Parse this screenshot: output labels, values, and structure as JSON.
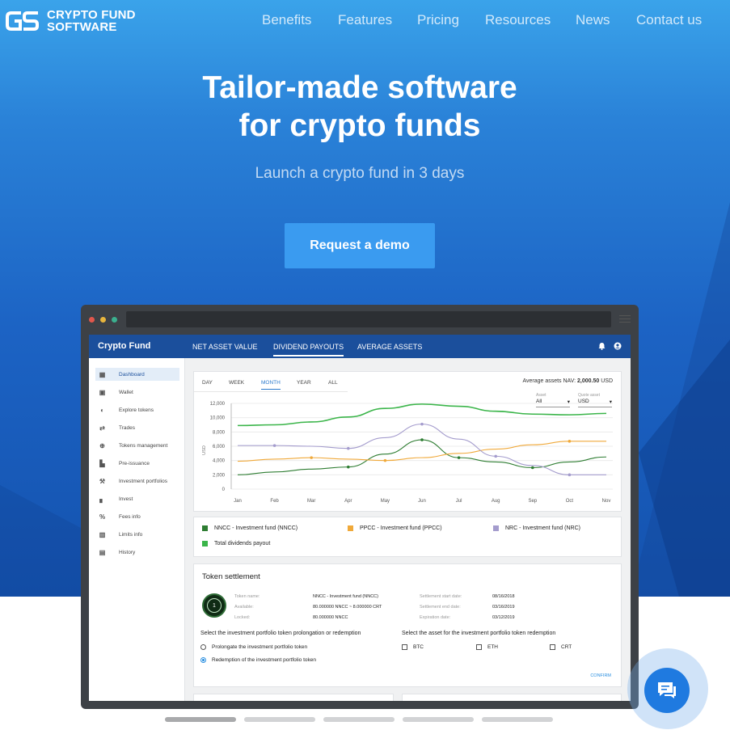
{
  "brand": {
    "line1": "CRYPTO FUND",
    "line2": "SOFTWARE",
    "mark": "GS"
  },
  "nav": [
    "Benefits",
    "Features",
    "Pricing",
    "Resources",
    "News",
    "Contact us"
  ],
  "hero": {
    "title_line1": "Tailor-made software",
    "title_line2": "for crypto funds",
    "subtitle": "Launch a crypto fund in 3 days",
    "cta": "Request a demo"
  },
  "app": {
    "title": "Crypto Fund",
    "tabs": [
      "NET ASSET VALUE",
      "DIVIDEND PAYOUTS",
      "AVERAGE ASSETS"
    ],
    "active_tab": 1,
    "sidebar": [
      {
        "label": "Dashboard",
        "icon": "dashboard-icon"
      },
      {
        "label": "Wallet",
        "icon": "wallet-icon"
      },
      {
        "label": "Explore tokens",
        "icon": "toggle-icon"
      },
      {
        "label": "Trades",
        "icon": "swap-icon"
      },
      {
        "label": "Tokens management",
        "icon": "plus-circle-icon"
      },
      {
        "label": "Pre-issuance",
        "icon": "document-icon"
      },
      {
        "label": "Investment portfolios",
        "icon": "gavel-icon"
      },
      {
        "label": "Invest",
        "icon": "signal-icon"
      },
      {
        "label": "Fees info",
        "icon": "percent-icon"
      },
      {
        "label": "Limits info",
        "icon": "bar-chart-icon"
      },
      {
        "label": "History",
        "icon": "history-icon"
      }
    ],
    "ranges": [
      "DAY",
      "WEEK",
      "MONTH",
      "YEAR",
      "ALL"
    ],
    "active_range": 2,
    "nav_label": "Average assets NAV:",
    "nav_value": "2,000.50",
    "nav_unit": "USD",
    "asset_select": {
      "caption": "Asset",
      "value": "All"
    },
    "quote_select": {
      "caption": "Quote asset",
      "value": "USD"
    },
    "legend": [
      "NNCC - Investment fund (NNCC)",
      "PPCC - Investment fund (PPCC)",
      "NRC - Investment fund (NRC)",
      "Total dividends payout"
    ],
    "token_settlement": {
      "title": "Token settlement",
      "badge": "1",
      "left_keys": [
        "Token name:",
        "Available:",
        "Locked:"
      ],
      "left_vals": [
        "NNCC - Investment fund (NNCC)",
        "80.000000 NNCC ~ 8.000000 CRT",
        "80.000000 NNCC"
      ],
      "right_keys": [
        "Settlement start date:",
        "Settlement end date:",
        "Expiration date:"
      ],
      "right_vals": [
        "08/16/2018",
        "03/16/2019",
        "03/12/2019"
      ],
      "q_left": "Select the investment portfolio token prolongation or redemption",
      "q_right": "Select the asset for the investment portfolio token redemption",
      "options": [
        "Prolongate the investment portfolio token",
        "Redemption of the investment portfolio token"
      ],
      "selected_option": 1,
      "assets": [
        "BTC",
        "ETH",
        "CRT"
      ],
      "confirm": "CONFIRM"
    }
  },
  "chart_data": {
    "type": "line",
    "categories": [
      "Jan",
      "Feb",
      "Mar",
      "Apr",
      "May",
      "Jun",
      "Jul",
      "Aug",
      "Sep",
      "Oct",
      "Nov"
    ],
    "ylabel": "USD",
    "ylim": [
      0,
      12000
    ],
    "yticks": [
      "12,000",
      "10,000",
      "8,000",
      "6,000",
      "4,000",
      "2,000",
      "0"
    ],
    "grid": true,
    "series": [
      {
        "name": "NNCC - Investment fund (NNCC)",
        "color": "#2e7d32",
        "values": [
          2000,
          2400,
          2800,
          3100,
          4900,
          6900,
          4400,
          3800,
          3000,
          3800,
          4500
        ],
        "markers": [
          3,
          5,
          6,
          8
        ]
      },
      {
        "name": "PPCC - Investment fund (PPCC)",
        "color": "#f0a93a",
        "values": [
          3900,
          4200,
          4400,
          4200,
          4000,
          4400,
          5000,
          5600,
          6200,
          6700,
          6700
        ],
        "markers": [
          2,
          4,
          9
        ]
      },
      {
        "name": "NRC - Investment fund (NRC)",
        "color": "#a49ccd",
        "values": [
          6100,
          6100,
          6000,
          5700,
          7200,
          9100,
          7000,
          4600,
          3300,
          2000,
          2000
        ],
        "markers": [
          1,
          3,
          5,
          7,
          9
        ]
      },
      {
        "name": "Total dividends payout",
        "color": "#3bb54a",
        "values": [
          8900,
          9000,
          9400,
          10100,
          11300,
          11900,
          11600,
          10900,
          10500,
          10400,
          10600
        ],
        "markers": []
      }
    ]
  }
}
